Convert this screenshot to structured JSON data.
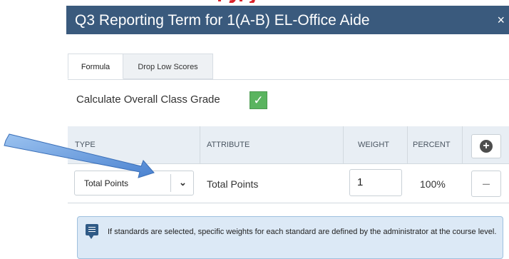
{
  "header": {
    "title": "Q3 Reporting Term for 1(A-B) EL-Office Aide",
    "close_glyph": "×"
  },
  "tabs": [
    {
      "label": "Formula",
      "active": true
    },
    {
      "label": "Drop Low Scores",
      "active": false
    }
  ],
  "calculate": {
    "label": "Calculate Overall Class Grade",
    "checked": true
  },
  "table": {
    "columns": [
      "TYPE",
      "ATTRIBUTE",
      "WEIGHT",
      "PERCENT"
    ],
    "rows": [
      {
        "type": "Total Points",
        "attribute": "Total Points",
        "weight": "1",
        "percent": "100%"
      }
    ]
  },
  "info": {
    "text": "If standards are selected, specific weights for each standard are defined by the administrator at the course level."
  },
  "colors": {
    "header_bg": "#3a5a7d",
    "checkbox_green": "#5ab45f",
    "info_bg": "#dce9f6",
    "annotation_arrow": "#5b8fd6"
  }
}
